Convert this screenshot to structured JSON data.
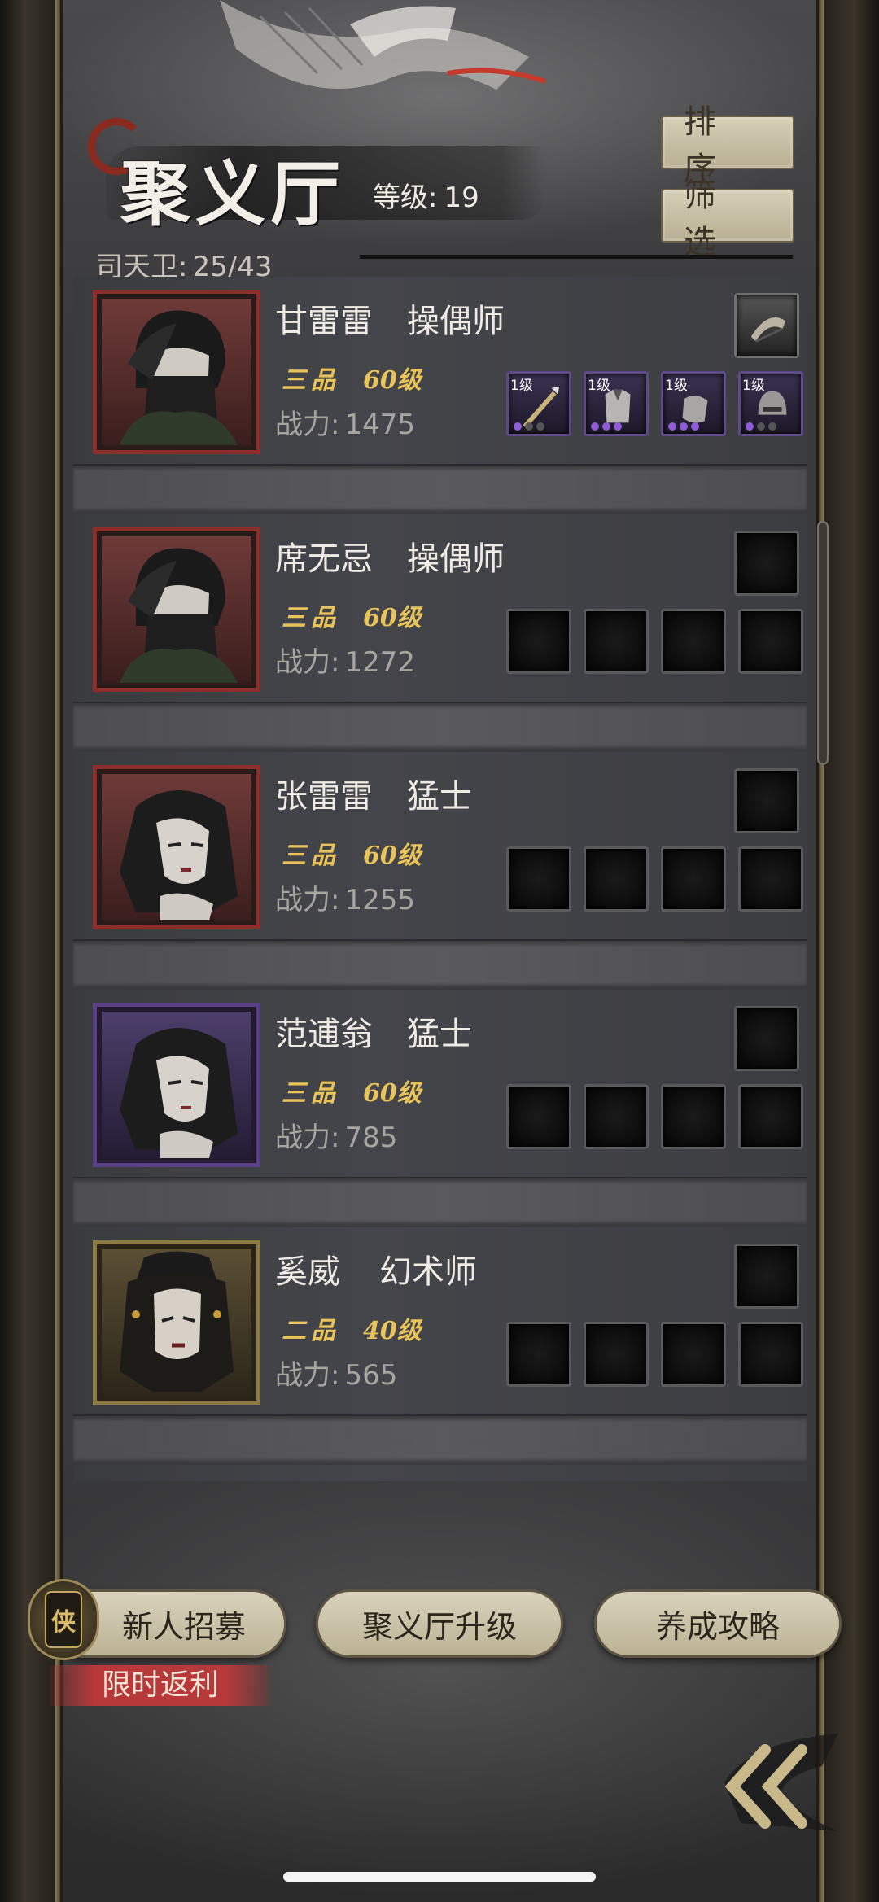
{
  "header": {
    "title": "聚义厅",
    "level_label": "等级:",
    "level_value": "19",
    "sort_label": "排序",
    "filter_label": "筛选",
    "guard_label": "司天卫:",
    "guard_count": "25/43"
  },
  "heroes": [
    {
      "name": "甘雷雷",
      "class": "操偶师",
      "rank": "三品",
      "level": "60级",
      "power_label": "战力:",
      "power": "1475",
      "frame": "red",
      "equip_filled": true,
      "equip_level": "1级"
    },
    {
      "name": "席无忌",
      "class": "操偶师",
      "rank": "三品",
      "level": "60级",
      "power_label": "战力:",
      "power": "1272",
      "frame": "red",
      "equip_filled": false
    },
    {
      "name": "张雷雷",
      "class": "猛士",
      "rank": "三品",
      "level": "60级",
      "power_label": "战力:",
      "power": "1255",
      "frame": "red",
      "equip_filled": false
    },
    {
      "name": "范逋翁",
      "class": "猛士",
      "rank": "三品",
      "level": "60级",
      "power_label": "战力:",
      "power": "785",
      "frame": "purple",
      "equip_filled": false
    },
    {
      "name": "奚威",
      "class": "幻术师",
      "rank": "二品",
      "level": "40级",
      "power_label": "战力:",
      "power": "565",
      "frame": "gold",
      "equip_filled": false
    }
  ],
  "footer": {
    "recruit_label": "新人招募",
    "recruit_icon_glyph": "侠",
    "promo_label": "限时返利",
    "upgrade_label": "聚义厅升级",
    "guide_label": "养成攻略",
    "back_icon": "double-chevron-left-icon"
  },
  "colors": {
    "accent_gold": "#e9c45a",
    "frame_red": "#8b2d2a",
    "frame_purple": "#5b3f86",
    "frame_gold": "#8c7a45",
    "button_tan": "#d6cfb6",
    "promo_red": "#b8393a"
  }
}
